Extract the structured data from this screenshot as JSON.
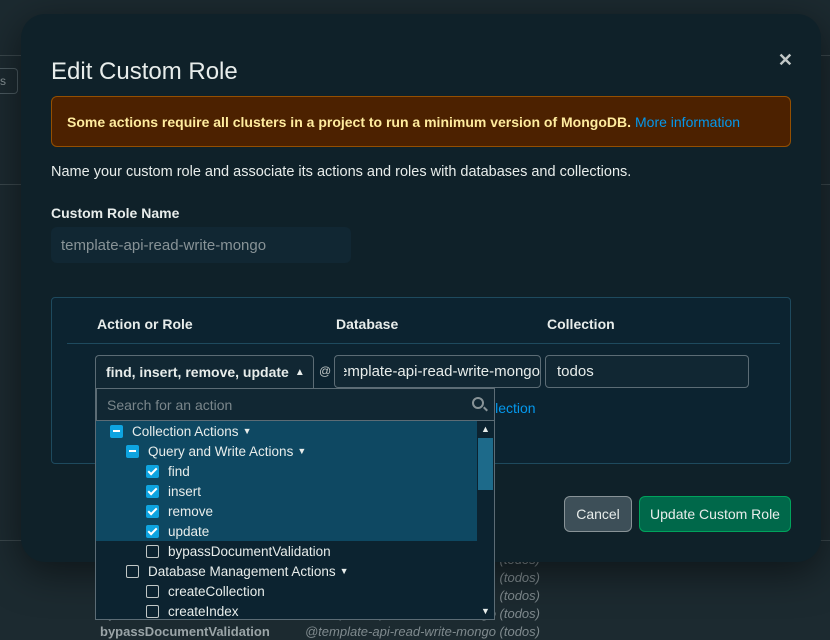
{
  "background": {
    "tab_fragment": "s",
    "rows": [
      {
        "role": "",
        "db": "(todos)"
      },
      {
        "role": "",
        "db": "(todos)"
      },
      {
        "role": "",
        "db": "(todos)"
      },
      {
        "role": "update",
        "db": "@template-api-read-write-mongo (todos)"
      },
      {
        "role": "bypassDocumentValidation",
        "db": "@template-api-read-write-mongo (todos)"
      }
    ]
  },
  "modal": {
    "title": "Edit Custom Role",
    "close": "✕",
    "banner_text": "Some actions require all clusters in a project to run a minimum version of MongoDB.",
    "banner_link": "More information",
    "description": "Name your custom role and associate its actions and roles with databases and collections.",
    "role_name_label": "Custom Role Name",
    "role_name_value": "template-api-read-write-mongo",
    "columns": {
      "action": "Action or Role",
      "database": "Database",
      "collection": "Collection"
    },
    "action_value": "find, insert, remove, update",
    "at_sign": "@",
    "database_value": "template-api-read-write-mongo",
    "collection_value": "todos",
    "add_collection_link": "llection",
    "cancel_label": "Cancel",
    "update_label": "Update Custom Role"
  },
  "dropdown": {
    "search_placeholder": "Search for an action",
    "items": [
      {
        "label": "Collection Actions",
        "state": "indet",
        "indent": 1,
        "expandable": true,
        "selected": true
      },
      {
        "label": "Query and Write Actions",
        "state": "indet",
        "indent": 2,
        "expandable": true,
        "selected": true
      },
      {
        "label": "find",
        "state": "checked",
        "indent": 3,
        "expandable": false,
        "selected": true
      },
      {
        "label": "insert",
        "state": "checked",
        "indent": 3,
        "expandable": false,
        "selected": true
      },
      {
        "label": "remove",
        "state": "checked",
        "indent": 3,
        "expandable": false,
        "selected": true
      },
      {
        "label": "update",
        "state": "checked",
        "indent": 3,
        "expandable": false,
        "selected": true
      },
      {
        "label": "bypassDocumentValidation",
        "state": "empty",
        "indent": 3,
        "expandable": false,
        "selected": false
      },
      {
        "label": "Database Management Actions",
        "state": "empty",
        "indent": 2,
        "expandable": true,
        "selected": false
      },
      {
        "label": "createCollection",
        "state": "empty",
        "indent": 3,
        "expandable": false,
        "selected": false
      },
      {
        "label": "createIndex",
        "state": "empty",
        "indent": 3,
        "expandable": false,
        "selected": false
      }
    ]
  },
  "colors": {
    "accent_blue": "#0ea4e0",
    "primary_green": "#00684a",
    "warning_bg": "#4c2100",
    "warning_text": "#ffec9e"
  }
}
